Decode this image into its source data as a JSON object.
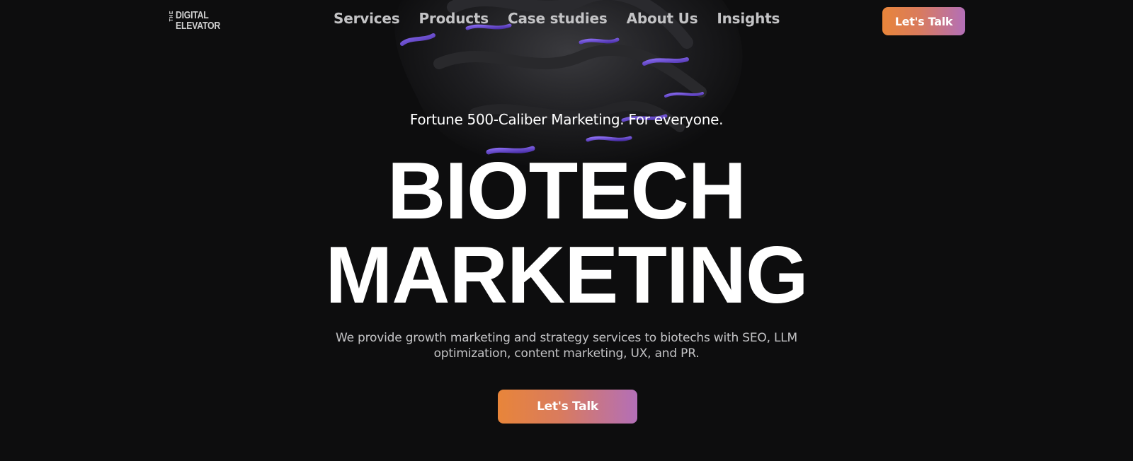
{
  "header": {
    "logo": {
      "small": "THE",
      "line1": "DIGITAL",
      "line2": "ELEVATOR"
    },
    "nav": [
      {
        "label": "Services"
      },
      {
        "label": "Products"
      },
      {
        "label": "Case studies"
      },
      {
        "label": "About Us"
      },
      {
        "label": "Insights"
      }
    ],
    "cta_label": "Let's Talk"
  },
  "hero": {
    "tagline": "Fortune 500-Caliber Marketing. For everyone.",
    "title_line1": "BIOTECH",
    "title_line2": "MARKETING",
    "description": "We provide growth marketing and strategy services to biotechs with SEO, LLM optimization, content marketing, UX, and PR.",
    "cta_label": "Let's Talk"
  },
  "colors": {
    "background": "#0d0d0e",
    "accent_start": "#e8853a",
    "accent_end": "#b36fb8",
    "blob_highlight": "#6b4fd0"
  }
}
